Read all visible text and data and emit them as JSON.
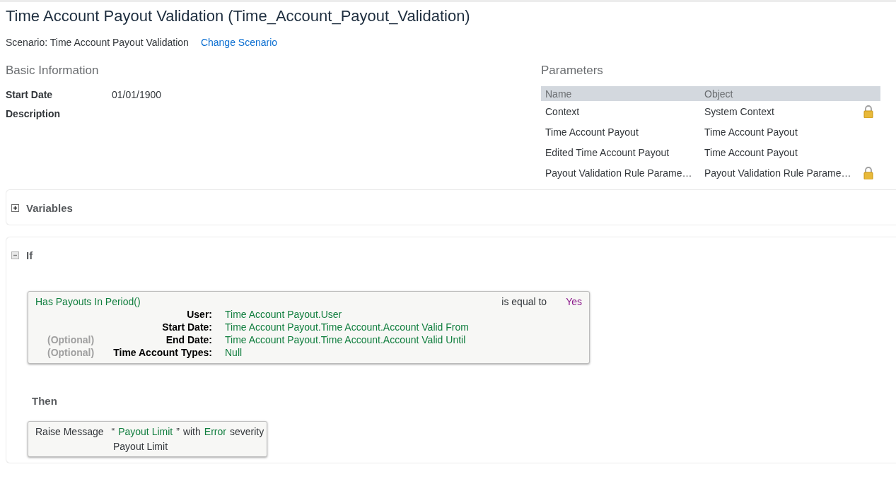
{
  "title": "Time Account Payout Validation (Time_Account_Payout_Validation)",
  "scenario": {
    "label": "Scenario: Time Account Payout Validation",
    "link": "Change Scenario"
  },
  "basic_info": {
    "heading": "Basic Information",
    "fields": [
      {
        "label": "Start Date",
        "value": "01/01/1900"
      },
      {
        "label": "Description"
      }
    ]
  },
  "parameters": {
    "heading": "Parameters",
    "columns": [
      "Name",
      "Object"
    ],
    "rows": [
      {
        "name": "Context",
        "object": "System Context",
        "locked": true
      },
      {
        "name": "Time Account Payout",
        "object": "Time Account Payout",
        "locked": false
      },
      {
        "name": "Edited Time Account Payout",
        "object": "Time Account Payout",
        "locked": false
      },
      {
        "name": "Payout Validation Rule Parame…",
        "object": "Payout Validation Rule Parame…",
        "locked": true
      }
    ]
  },
  "variables": {
    "title": "Variables",
    "expanded": false
  },
  "if_block": {
    "title": "If",
    "expanded": true,
    "condition": {
      "function": "Has Payouts In Period()",
      "operator": "is equal to",
      "value": "Yes",
      "args": [
        {
          "label": "User:",
          "value": "Time Account Payout.User"
        },
        {
          "label": "Start Date:",
          "value": "Time Account Payout.Time Account.Account Valid From"
        },
        {
          "optional_label": "(Optional)",
          "label": "End Date:",
          "value": "Time Account Payout.Time Account.Account Valid Until"
        },
        {
          "optional_label": "(Optional)",
          "label": "Time Account Types:",
          "value": "Null"
        }
      ]
    },
    "then_label": "Then",
    "action": {
      "verb": "Raise Message",
      "open_quote": "“",
      "message": "Payout Limit",
      "close_quote": "”",
      "connector": "with",
      "severity": "Error",
      "suffix": "severity",
      "detail": "Payout Limit"
    }
  }
}
